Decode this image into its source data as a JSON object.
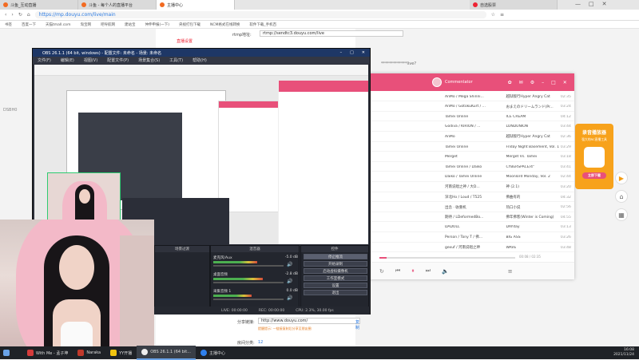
{
  "browser": {
    "tabs": [
      {
        "label": "斗鱼_互动直播"
      },
      {
        "label": "斗鱼 - 每个人的直播平台"
      },
      {
        "label": "主播中心"
      },
      {
        "label": "自选股票"
      }
    ],
    "url": "https://mp.douyu.com/live/main",
    "bookmarks": [
      "书签",
      "百度一下",
      "天猫tmall.com",
      "淘宝网",
      "吧导航网",
      "建站宝",
      "仲伸申报(一下)",
      "央视打包下载",
      "NCM格式在线转换",
      "软件下载_手机百"
    ]
  },
  "page": {
    "sidebar_link": "直播设置",
    "rtmp_label": "rtmp地址:",
    "rtmp_value": "rtmp://sendtc3.douyu.com/live",
    "masked_code": "*************live?",
    "share_label": "分享链接:",
    "share_value": "http://www.douyu.com/",
    "copy_label": "复制",
    "share_hint": "提醒提示: 一链接复制后分享至朋友圈",
    "count_label": "房间分类:",
    "count_value": "12",
    "left_code": "DSBH0"
  },
  "player": {
    "user": "Commentator",
    "tracks": [
      {
        "artist": "AnMo / Mega Shinni...",
        "album": "越狱版行Hyper Angry Cat",
        "time": "02:35"
      },
      {
        "artist": "AnMo / GotokuKurt / ...",
        "album": "おまえのドリームランド(Pr...",
        "time": "03:24"
      },
      {
        "artist": "Tamei Online",
        "album": "ICE CREAM",
        "time": "04:12"
      },
      {
        "artist": "Godiva / KIRION / ...",
        "album": "LONDUNION",
        "time": "03:44"
      },
      {
        "artist": "AnMo",
        "album": "越狱版行Hyper Angry Cat",
        "time": "02:36"
      },
      {
        "artist": "Tamei Online",
        "album": "Friday Night Basement, Vol. 1",
        "time": "03:29"
      },
      {
        "artist": "Merget",
        "album": "Merget Vs. Tamei",
        "time": "03:18"
      },
      {
        "artist": "Tamei Online / Daiko",
        "album": "CYBERSPACE/4\"",
        "time": "03:41"
      },
      {
        "artist": "Daiko / Tamei Online",
        "album": "Moonlord Monday, Vol. 2",
        "time": "02:44"
      },
      {
        "artist": "河南说唱之神 / 大D...",
        "album": "神 (2.1)",
        "time": "03:20"
      },
      {
        "artist": "深北Ho / Loud / T525",
        "album": "佛曲有的",
        "time": "04:32"
      },
      {
        "artist": "出念 · 收重机",
        "album": "热口小说",
        "time": "02:56"
      },
      {
        "artist": "期待 / LDeformedBo...",
        "album": "佛年佛客(Winter is Coming)",
        "time": "04:55"
      },
      {
        "artist": "DADOLL",
        "album": "DAYday",
        "time": "03:13"
      },
      {
        "artist": "Person / Tony T / 佛...",
        "album": "BIG ASS",
        "time": "03:26"
      },
      {
        "artist": "gexuf / 河南说唱之神",
        "album": "WAVE",
        "time": "03:48"
      }
    ],
    "progress_time": "00:08 / 02:35",
    "progress": 0.05
  },
  "obs": {
    "title": "OBS 26.1.1 (64 bit, windows) - 配置文件: 未命名 - 场景: 未命名",
    "menu": [
      "文件(F)",
      "编辑(E)",
      "视图(V)",
      "配置文件(P)",
      "场景集合(S)",
      "工具(T)",
      "帮助(H)"
    ],
    "scene_header": "场景过渡",
    "mixer_header": "混音器",
    "controls_header": "控件",
    "channels": [
      {
        "name": "麦克风/Aux",
        "db": "-5.0 dB",
        "level": 0.62
      },
      {
        "name": "桌面音频",
        "db": "-2.8 dB",
        "level": 0.7
      },
      {
        "name": "采集音频 1",
        "db": "0.0 dB",
        "level": 0.55
      }
    ],
    "buttons": [
      "停止推流",
      "开始录制",
      "启动虚拟摄像机",
      "工作室模式",
      "设置",
      "退出"
    ],
    "status": {
      "live": "LIVE: 00:00:00",
      "rec": "REC: 00:00:00",
      "cpu": "CPU: 2.3%, 30.00 fps"
    }
  },
  "ad": {
    "title": "录音播放器",
    "subtitle": "强大的RC直播工具",
    "button": "立即下载"
  },
  "taskbar": {
    "items": [
      {
        "label": "With Me - 孟子坤",
        "color": "#d43c3c"
      },
      {
        "label": "Naraka",
        "color": "#c0392b"
      },
      {
        "label": "YY开播",
        "color": "#f1c40f"
      },
      {
        "label": "OBS 26.1.1 (64 bit...",
        "color": "#eeeeee"
      },
      {
        "label": "主播中心",
        "color": "#2f80ed"
      }
    ],
    "time": "16:08",
    "date": "2021/11/24"
  }
}
